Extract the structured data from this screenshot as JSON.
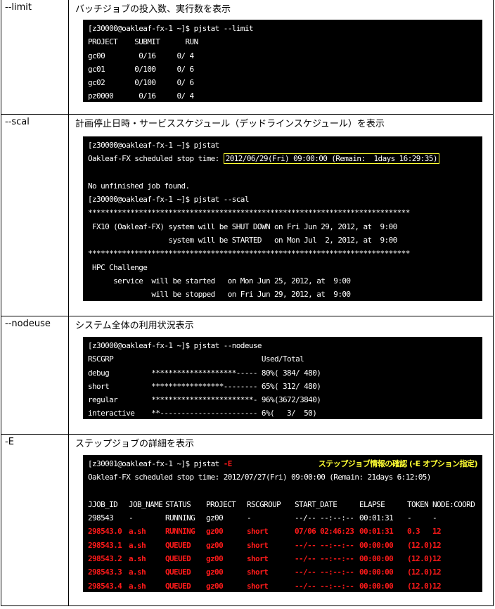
{
  "rows": [
    {
      "option": "--limit",
      "description": "バッチジョブの投入数、実行数を表示",
      "terminal": {
        "lines": [
          "[z30000@oakleaf-fx-1 ~]$ pjstat --limit",
          "PROJECT    SUBMIT      RUN",
          "gc00        0/16     0/ 4",
          "gc01       0/100     0/ 6",
          "gc02       0/100     0/ 6",
          "pz0000      0/16     0/ 4"
        ]
      }
    },
    {
      "option": "--scal",
      "description": "計画停止日時・サービススケジュール（デッドラインスケジュール）を表示",
      "terminal": {
        "prompt1": "[z30000@oakleaf-fx-1 ~]$ pjstat",
        "stop_prefix": "Oakleaf-FX scheduled stop time: ",
        "stop_highlight": "2012/06/29(Fri) 09:00:00 (Remain:  1days 16:29:35)",
        "blank": "",
        "no_job": "No unfinished job found.",
        "prompt2": "[z30000@oakleaf-fx-1 ~]$ pjstat --scal",
        "stars1": "****************************************************************************",
        "shutdown": " FX10 (Oakleaf-FX) system will be SHUT DOWN on Fri Jun 29, 2012, at  9:00",
        "started": "                   system will be STARTED   on Mon Jul  2, 2012, at  9:00",
        "stars2": "****************************************************************************",
        "hpc": " HPC Challenge",
        "svc_start": "      service  will be started   on Mon Jun 25, 2012, at  9:00",
        "svc_stop": "               will be stopped   on Fri Jun 29, 2012, at  9:00"
      }
    },
    {
      "option": "--nodeuse",
      "description": "システム全体の利用状況表示",
      "terminal": {
        "prompt": "[z30000@oakleaf-fx-1 ~]$ pjstat --nodeuse",
        "header": "RSCGRP                                   Used/Total",
        "groups": [
          {
            "line": "debug          ********************----- 80%( 384/ 480)",
            "name": "debug",
            "percent": 80,
            "used": 384,
            "total": 480
          },
          {
            "line": "short          *****************-------- 65%( 312/ 480)",
            "name": "short",
            "percent": 65,
            "used": 312,
            "total": 480
          },
          {
            "line": "regular        ************************- 96%(3672/3840)",
            "name": "regular",
            "percent": 96,
            "used": 3672,
            "total": 3840
          },
          {
            "line": "interactive    **----------------------- 6%(   3/  50)",
            "name": "interactive",
            "percent": 6,
            "used": 3,
            "total": 50
          }
        ]
      }
    },
    {
      "option": "-E",
      "description": "ステップジョブの詳細を表示",
      "terminal": {
        "prompt": "[z30001@oakleaf-fx-1 ~]$ pjstat ",
        "prompt_flag": "-E",
        "annotation": "ステップジョブ情報の確認 (-E オプション指定)",
        "stop_line": "Oakleaf-FX scheduled stop time: 2012/07/27(Fri) 09:00:00 (Remain: 21days 6:12:05)",
        "blank": "",
        "columns": [
          "JJOB_ID",
          "JOB_NAME",
          "STATUS",
          "PROJECT",
          "RSCGROUP",
          "START_DATE",
          "ELAPSE",
          "TOKEN",
          "NODE:COORD"
        ],
        "jobs": [
          {
            "id": "298543",
            "name": "-",
            "status": "RUNNING",
            "project": "gz00",
            "rscgroup": "-",
            "start": "--/-- --:--:--",
            "elapse": "00:01:31",
            "token": "-",
            "node": "-",
            "highlight": false
          },
          {
            "id": "298543.0",
            "name": "a.sh",
            "status": "RUNNING",
            "project": "gz00",
            "rscgroup": "short",
            "start": "07/06 02:46:23",
            "elapse": "00:01:31",
            "token": "0.3",
            "node": "12",
            "highlight": true
          },
          {
            "id": "298543.1",
            "name": "a.sh",
            "status": "QUEUED",
            "project": "gz00",
            "rscgroup": "short",
            "start": "--/-- --:--:--",
            "elapse": "00:00:00",
            "token": "(12.0)",
            "node": "12",
            "highlight": true
          },
          {
            "id": "298543.2",
            "name": "a.sh",
            "status": "QUEUED",
            "project": "gz00",
            "rscgroup": "short",
            "start": "--/-- --:--:--",
            "elapse": "00:00:00",
            "token": "(12.0)",
            "node": "12",
            "highlight": true
          },
          {
            "id": "298543.3",
            "name": "a.sh",
            "status": "QUEUED",
            "project": "gz00",
            "rscgroup": "short",
            "start": "--/-- --:--:--",
            "elapse": "00:00:00",
            "token": "(12.0)",
            "node": "12",
            "highlight": true
          },
          {
            "id": "298543.4",
            "name": "a.sh",
            "status": "QUEUED",
            "project": "gz00",
            "rscgroup": "short",
            "start": "--/-- --:--:--",
            "elapse": "00:00:00",
            "token": "(12.0)",
            "node": "12",
            "highlight": true
          }
        ]
      }
    }
  ],
  "colors": {
    "terminal_bg": "#000000",
    "terminal_fg": "#ffffff",
    "highlight_red": "#ff1a1a",
    "annotation_yellow": "#ffff33"
  }
}
